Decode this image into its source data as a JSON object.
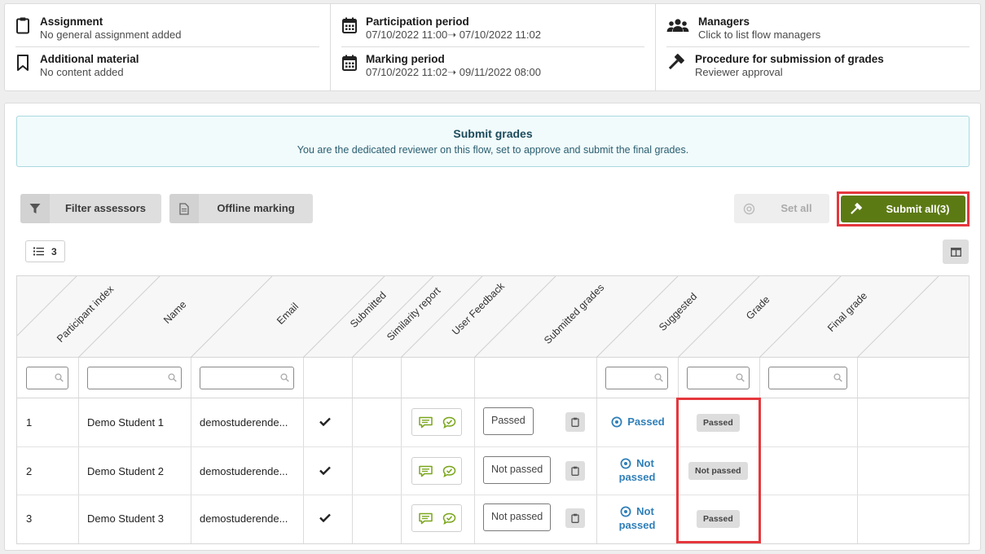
{
  "info": {
    "assignment": {
      "title": "Assignment",
      "value": "No general assignment added"
    },
    "additional_material": {
      "title": "Additional material",
      "value": "No content added"
    },
    "participation_period": {
      "title": "Participation period",
      "value": "07/10/2022 11:00➝ 07/10/2022 11:02"
    },
    "marking_period": {
      "title": "Marking period",
      "value": "07/10/2022 11:02➝ 09/11/2022 08:00"
    },
    "managers": {
      "title": "Managers",
      "value": "Click to list flow managers"
    },
    "procedure": {
      "title": "Procedure for submission of grades",
      "value": "Reviewer approval"
    }
  },
  "banner": {
    "title": "Submit grades",
    "text": "You are the dedicated reviewer on this flow, set to approve and submit the final grades."
  },
  "toolbar": {
    "filter_assessors": "Filter assessors",
    "offline_marking": "Offline marking",
    "set_all": "Set all",
    "submit_all": "Submit all(3)",
    "row_count": "3"
  },
  "table": {
    "headers": [
      "Participant index",
      "Name",
      "Email",
      "Submitted",
      "Similarity report",
      "User Feedback",
      "Submitted grades",
      "Suggested",
      "Grade",
      "Final grade"
    ],
    "rows": [
      {
        "index": "1",
        "name": "Demo Student 1",
        "email": "demostuderende...",
        "submitted_grade": "Passed",
        "suggested_l1": "Passed",
        "suggested_l2": "",
        "grade": "Passed"
      },
      {
        "index": "2",
        "name": "Demo Student 2",
        "email": "demostuderende...",
        "submitted_grade": "Not passed",
        "suggested_l1": "Not",
        "suggested_l2": "passed",
        "grade": "Not passed"
      },
      {
        "index": "3",
        "name": "Demo Student 3",
        "email": "demostuderende...",
        "submitted_grade": "Not passed",
        "suggested_l1": "Not",
        "suggested_l2": "passed",
        "grade": "Passed"
      }
    ]
  },
  "colors": {
    "submit": "#5c7a14",
    "highlight": "#e5373d",
    "link": "#2f7fb8",
    "banner_bg": "#f1fbfc"
  },
  "icons": [
    "clipboard-icon",
    "bookmark-icon",
    "calendar-icon",
    "users-icon",
    "gavel-icon",
    "filter-icon",
    "document-icon",
    "target-icon",
    "list-icon",
    "columns-icon",
    "search-icon",
    "checkmark-icon",
    "comment-icon",
    "comment-check-icon"
  ]
}
